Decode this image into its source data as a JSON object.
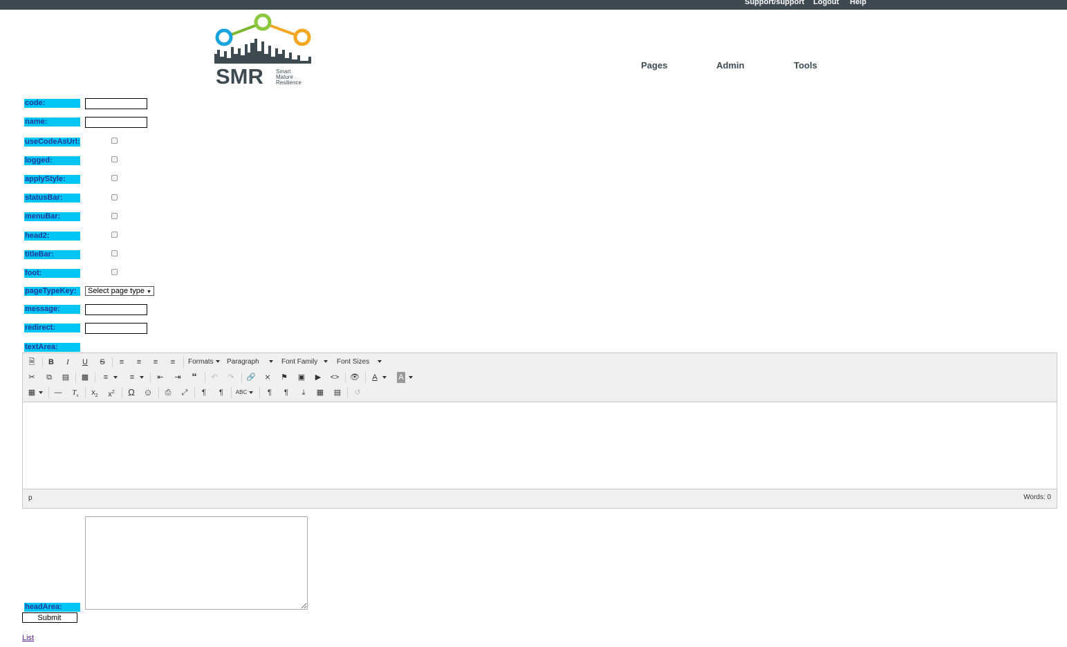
{
  "header": {
    "user_link": "Support/support",
    "logout": "Logout",
    "help": "Help",
    "logo": {
      "title": "SMR",
      "subtitle": [
        "Smart",
        "Mature",
        "Resilience"
      ]
    },
    "nav": [
      "Pages",
      "Admin",
      "Tools"
    ]
  },
  "form": {
    "labels": {
      "code": "code:",
      "name": "name:",
      "useCodeAsUrl": "useCodeAsUrl:",
      "logged": "logged:",
      "applyStyle": "applyStyle:",
      "statusBar": "statusBar:",
      "menuBar": "menuBar:",
      "head2": "head2:",
      "titleBar": "titleBar:",
      "foot": "foot:",
      "pageTypeKey": "pageTypeKey:",
      "message": "message:",
      "redirect": "redirect:",
      "textArea": "textArea:",
      "headArea": "headArea:"
    },
    "values": {
      "code": "",
      "name": "",
      "message": "",
      "redirect": "",
      "headArea": ""
    },
    "checkboxes": {
      "useCodeAsUrl": false,
      "logged": false,
      "applyStyle": false,
      "statusBar": false,
      "menuBar": false,
      "head2": false,
      "titleBar": false,
      "foot": false
    },
    "pageTypeKey_selected": "Select page type",
    "submit_label": "Submit",
    "list_link": "List"
  },
  "editor": {
    "dropdowns": {
      "formats": "Formats",
      "paragraph": "Paragraph",
      "font_family": "Font Family",
      "font_sizes": "Font Sizes"
    },
    "status_path": "p",
    "word_count": "Words: 0"
  },
  "colors": {
    "topbar": "#3d4a52",
    "label_bg": "#00c4f5",
    "label_text": "#1a3d9a"
  }
}
